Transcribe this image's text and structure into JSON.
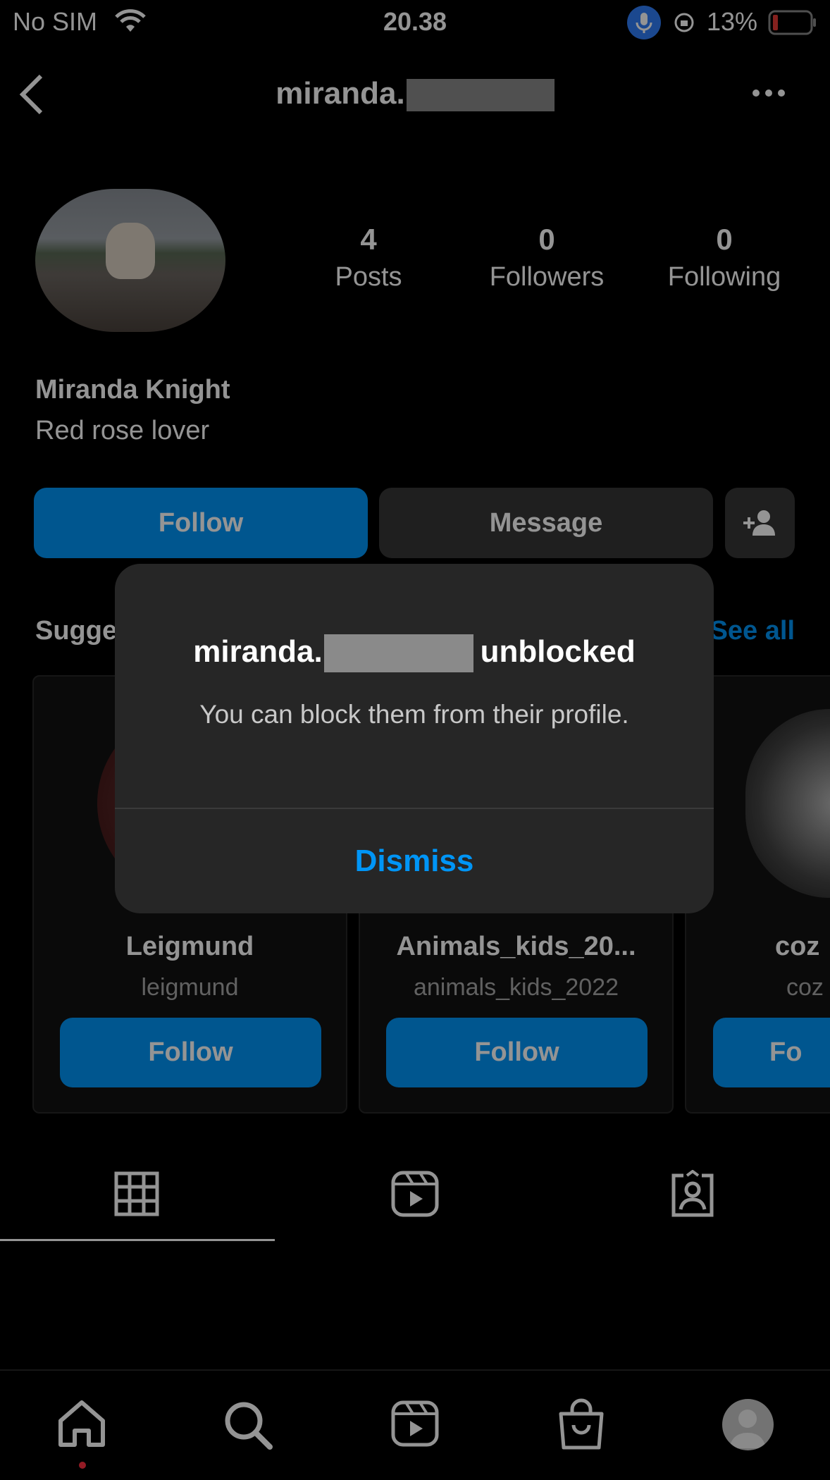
{
  "status_bar": {
    "carrier": "No SIM",
    "time": "20.38",
    "battery": "13%",
    "icons": [
      "wifi-icon",
      "microphone-icon",
      "rotation-lock-icon",
      "battery-icon"
    ]
  },
  "header": {
    "username": "miranda.",
    "icons": [
      "back-chevron-icon",
      "more-icon"
    ]
  },
  "profile": {
    "posts_count": "4",
    "posts_label": "Posts",
    "followers_count": "0",
    "followers_label": "Followers",
    "following_count": "0",
    "following_label": "Following",
    "name": "Miranda Knight",
    "bio": "Red rose lover"
  },
  "actions": {
    "follow": "Follow",
    "message": "Message"
  },
  "suggested": {
    "title": "Suggested",
    "see_all": "See all",
    "cards": [
      {
        "name": "Leigmund",
        "username": "leigmund",
        "button": "Follow"
      },
      {
        "name": "Animals_kids_20...",
        "username": "animals_kids_2022",
        "button": "Follow"
      },
      {
        "name": "coz",
        "username": "coz",
        "button": "Fo"
      }
    ]
  },
  "tabs": [
    "grid-icon",
    "reels-icon",
    "tagged-icon"
  ],
  "bottom_nav": [
    "home-icon",
    "search-icon",
    "reels-icon",
    "shop-icon",
    "profile-avatar"
  ],
  "dialog": {
    "title_prefix": "miranda.",
    "title_suffix": "unblocked",
    "body": "You can block them from their profile.",
    "dismiss": "Dismiss"
  },
  "colors": {
    "accent": "#0095f6",
    "background": "#000000",
    "dialog": "#262626"
  }
}
